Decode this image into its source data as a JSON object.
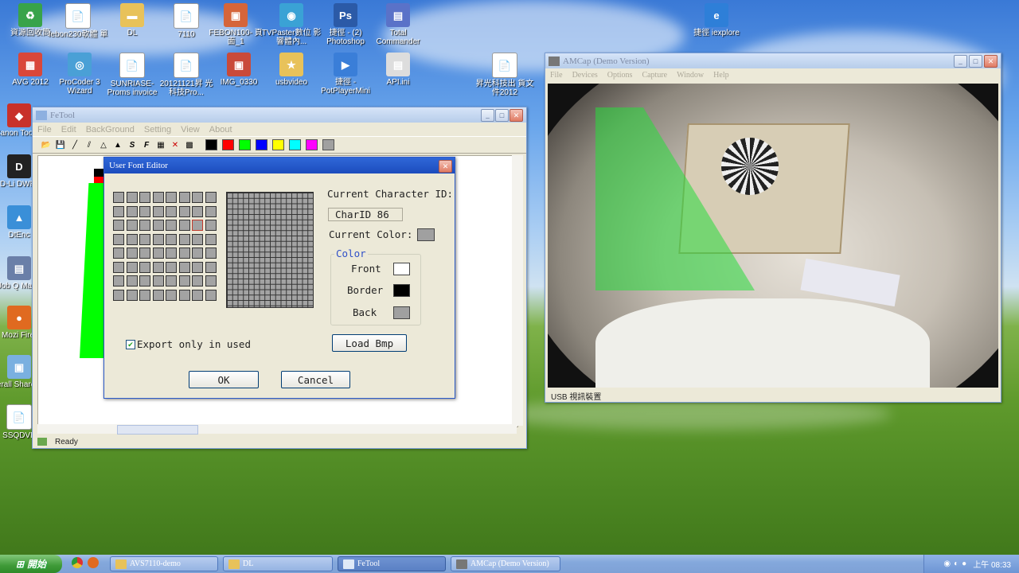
{
  "desktop": {
    "icons": [
      {
        "label": "資源回收筒",
        "glyph": "♻",
        "color": "#38a34a"
      },
      {
        "label": "febon230軟體 單",
        "glyph": "📄",
        "color": "#fff"
      },
      {
        "label": "DL",
        "glyph": "▬",
        "color": "#e8c25a"
      },
      {
        "label": "7110",
        "glyph": "📄",
        "color": "#fff"
      },
      {
        "label": "FEBON100- 頁面_1",
        "glyph": "▣",
        "color": "#d5653a"
      },
      {
        "label": "TVPaster數位 影響體內...",
        "glyph": "◉",
        "color": "#3aa2d5"
      },
      {
        "label": "捷徑 - (2) Photoshop",
        "glyph": "Ps",
        "color": "#2b5aa7"
      },
      {
        "label": "Total Commander",
        "glyph": "▤",
        "color": "#5a72c8"
      },
      {
        "label": "捷徑 iexplore",
        "glyph": "e",
        "color": "#2e7fd8"
      },
      {
        "label": "AVG 2012",
        "glyph": "▦",
        "color": "#d9473a"
      },
      {
        "label": "ProCoder 3 Wizard",
        "glyph": "◎",
        "color": "#4aa0d6"
      },
      {
        "label": "SUNRIASE- Proms invoice",
        "glyph": "📄",
        "color": "#fff"
      },
      {
        "label": "20121121昇 光科技Pro...",
        "glyph": "📄",
        "color": "#fff"
      },
      {
        "label": "IMG_0330",
        "glyph": "▣",
        "color": "#c94a3a"
      },
      {
        "label": "usbvideo",
        "glyph": "★",
        "color": "#e8c25a"
      },
      {
        "label": "捷徑 - PotPlayerMini",
        "glyph": "▶",
        "color": "#3a7ed8"
      },
      {
        "label": "API.ini",
        "glyph": "▤",
        "color": "#ddd"
      },
      {
        "label": "昇光科技出 貨文件2012",
        "glyph": "📄",
        "color": "#fff"
      },
      {
        "label": "Canon Toolbo",
        "glyph": "◆",
        "color": "#c8312a"
      },
      {
        "label": "D-Li DWR-",
        "glyph": "D",
        "color": "#222"
      },
      {
        "label": "DtEnc",
        "glyph": "▲",
        "color": "#3a8fd8"
      },
      {
        "label": "Job Q Mana",
        "glyph": "▤",
        "color": "#6a7fa8"
      },
      {
        "label": "Mozi Firef",
        "glyph": "●",
        "color": "#e06a20"
      },
      {
        "label": "Perall Shared F",
        "glyph": "▣",
        "color": "#7ab0e0"
      },
      {
        "label": "SSQDVE",
        "glyph": "📄",
        "color": "#fff"
      }
    ]
  },
  "fetool": {
    "title": "FeTool",
    "menu": [
      "File",
      "Edit",
      "BackGround",
      "Setting",
      "View",
      "About"
    ],
    "status": "Ready",
    "colors": [
      "#000000",
      "#ff0000",
      "#00ff00",
      "#0000ff",
      "#ffff00",
      "#00ffff",
      "#ff00ff",
      "#a0a0a0"
    ]
  },
  "font_editor": {
    "title": "User Font Editor",
    "char_id_label": "Current Character ID:",
    "char_id_value": "CharID 86",
    "current_color_label": "Current Color:",
    "color_group_label": "Color",
    "front_label": "Front",
    "border_label": "Border",
    "back_label": "Back",
    "load_bmp": "Load Bmp",
    "export_only": "Export only in used",
    "export_checked": true,
    "ok": "OK",
    "cancel": "Cancel",
    "front_color": "#ffffff",
    "border_color": "#000000",
    "back_color": "#a0a0a0",
    "current_color": "#a0a0a0"
  },
  "amcap": {
    "title": "AMCap (Demo Version)",
    "menu": [
      "File",
      "Devices",
      "Options",
      "Capture",
      "Window",
      "Help"
    ],
    "status": "USB 視訊裝置"
  },
  "taskbar": {
    "start": "開始",
    "items": [
      "AVS7110-demo",
      "DL",
      "FeTool",
      "AMCap (Demo Version)"
    ],
    "clock": "上午 08:33"
  }
}
